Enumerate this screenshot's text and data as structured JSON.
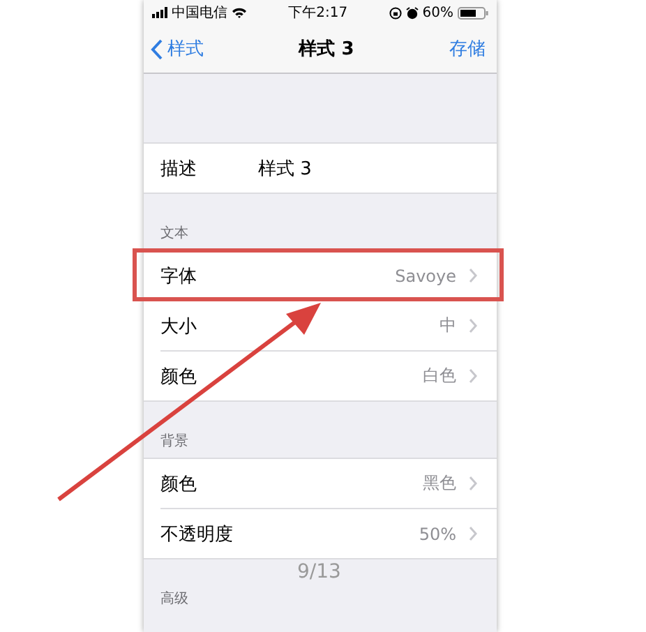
{
  "status_bar": {
    "carrier": "中国电信",
    "time": "下午2:17",
    "battery_text": "60%"
  },
  "nav_bar": {
    "back": "样式",
    "title": "样式 3",
    "action": "存储"
  },
  "sections": [
    {
      "rows": [
        {
          "kind": "text",
          "label": "描述",
          "value": "样式 3",
          "highlighted": false
        }
      ]
    },
    {
      "header": "文本",
      "rows": [
        {
          "kind": "disclosure",
          "label": "字体",
          "value": "Savoye",
          "highlighted": true
        },
        {
          "kind": "disclosure",
          "label": "大小",
          "value": "中",
          "highlighted": false
        },
        {
          "kind": "disclosure",
          "label": "颜色",
          "value": "白色",
          "highlighted": false
        }
      ]
    },
    {
      "header": "背景",
      "rows": [
        {
          "kind": "disclosure",
          "label": "颜色",
          "value": "黑色",
          "highlighted": false
        },
        {
          "kind": "disclosure",
          "label": "不透明度",
          "value": "50%",
          "highlighted": false
        }
      ]
    },
    {
      "header": "高级"
    }
  ],
  "page_counter": "9/13"
}
